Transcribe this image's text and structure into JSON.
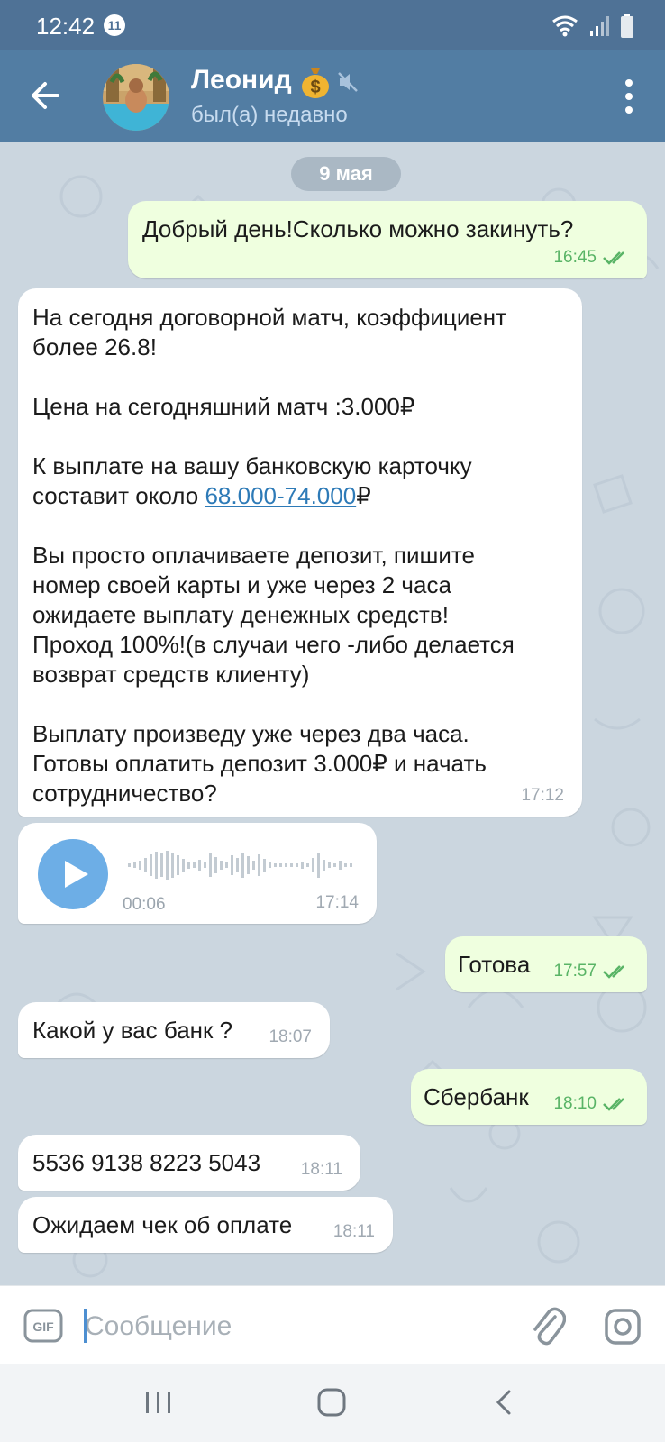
{
  "status_bar": {
    "time": "12:42",
    "notification_count": "11"
  },
  "header": {
    "contact_name": "Леонид",
    "contact_status": "был(а) недавно"
  },
  "chat": {
    "date_label": "9 мая",
    "messages": [
      {
        "direction": "out",
        "text": "Добрый день!Сколько можно закинуть?",
        "time": "16:45",
        "read": true
      },
      {
        "direction": "in",
        "text_part1": "На сегодня договорной матч, коэффициент\nболее 26.8!\n\nЦена на сегодняшний матч :3.000₽\n\nК выплате на вашу банковскую карточку\nсоставит около ",
        "link": "68.000-74.000",
        "text_part2": "₽\n\nВы просто оплачиваете депозит, пишите\nномер своей карты и уже через 2 часа\nожидаете выплату денежных средств!\nПроход 100%!(в случаи чего -либо делается\nвозврат средств клиенту)\n\nВыплату произведу уже через два часа.\nГотовы оплатить депозит 3.000₽ и начать\nсотрудничество?",
        "time": "17:12"
      },
      {
        "direction": "in",
        "type": "voice",
        "duration": "00:06",
        "time": "17:14"
      },
      {
        "direction": "out",
        "text": "Готова",
        "time": "17:57",
        "read": true
      },
      {
        "direction": "in",
        "text": "Какой у вас банк ?",
        "time": "18:07"
      },
      {
        "direction": "out",
        "text": "Сбербанк",
        "time": "18:10",
        "read": true
      },
      {
        "direction": "in",
        "text": "5536 9138 8223 5043",
        "time": "18:11"
      },
      {
        "direction": "in",
        "text": "Ожидаем чек об оплате",
        "time": "18:11"
      }
    ]
  },
  "input": {
    "placeholder": "Сообщение"
  },
  "colors": {
    "header": "#527da3",
    "status_bar": "#4f7296",
    "outgoing_bubble": "#efffdf",
    "incoming_bubble": "#ffffff",
    "check_marks": "#59b466",
    "link": "#2d7ab7",
    "voice_button": "#6daee6"
  },
  "icons": [
    "back-arrow-icon",
    "money-bag-icon",
    "mute-icon",
    "more-vertical-icon",
    "double-check-icon",
    "play-icon",
    "gif-icon",
    "paperclip-icon",
    "camera-icon",
    "recent-apps-icon",
    "home-icon",
    "back-nav-icon"
  ]
}
